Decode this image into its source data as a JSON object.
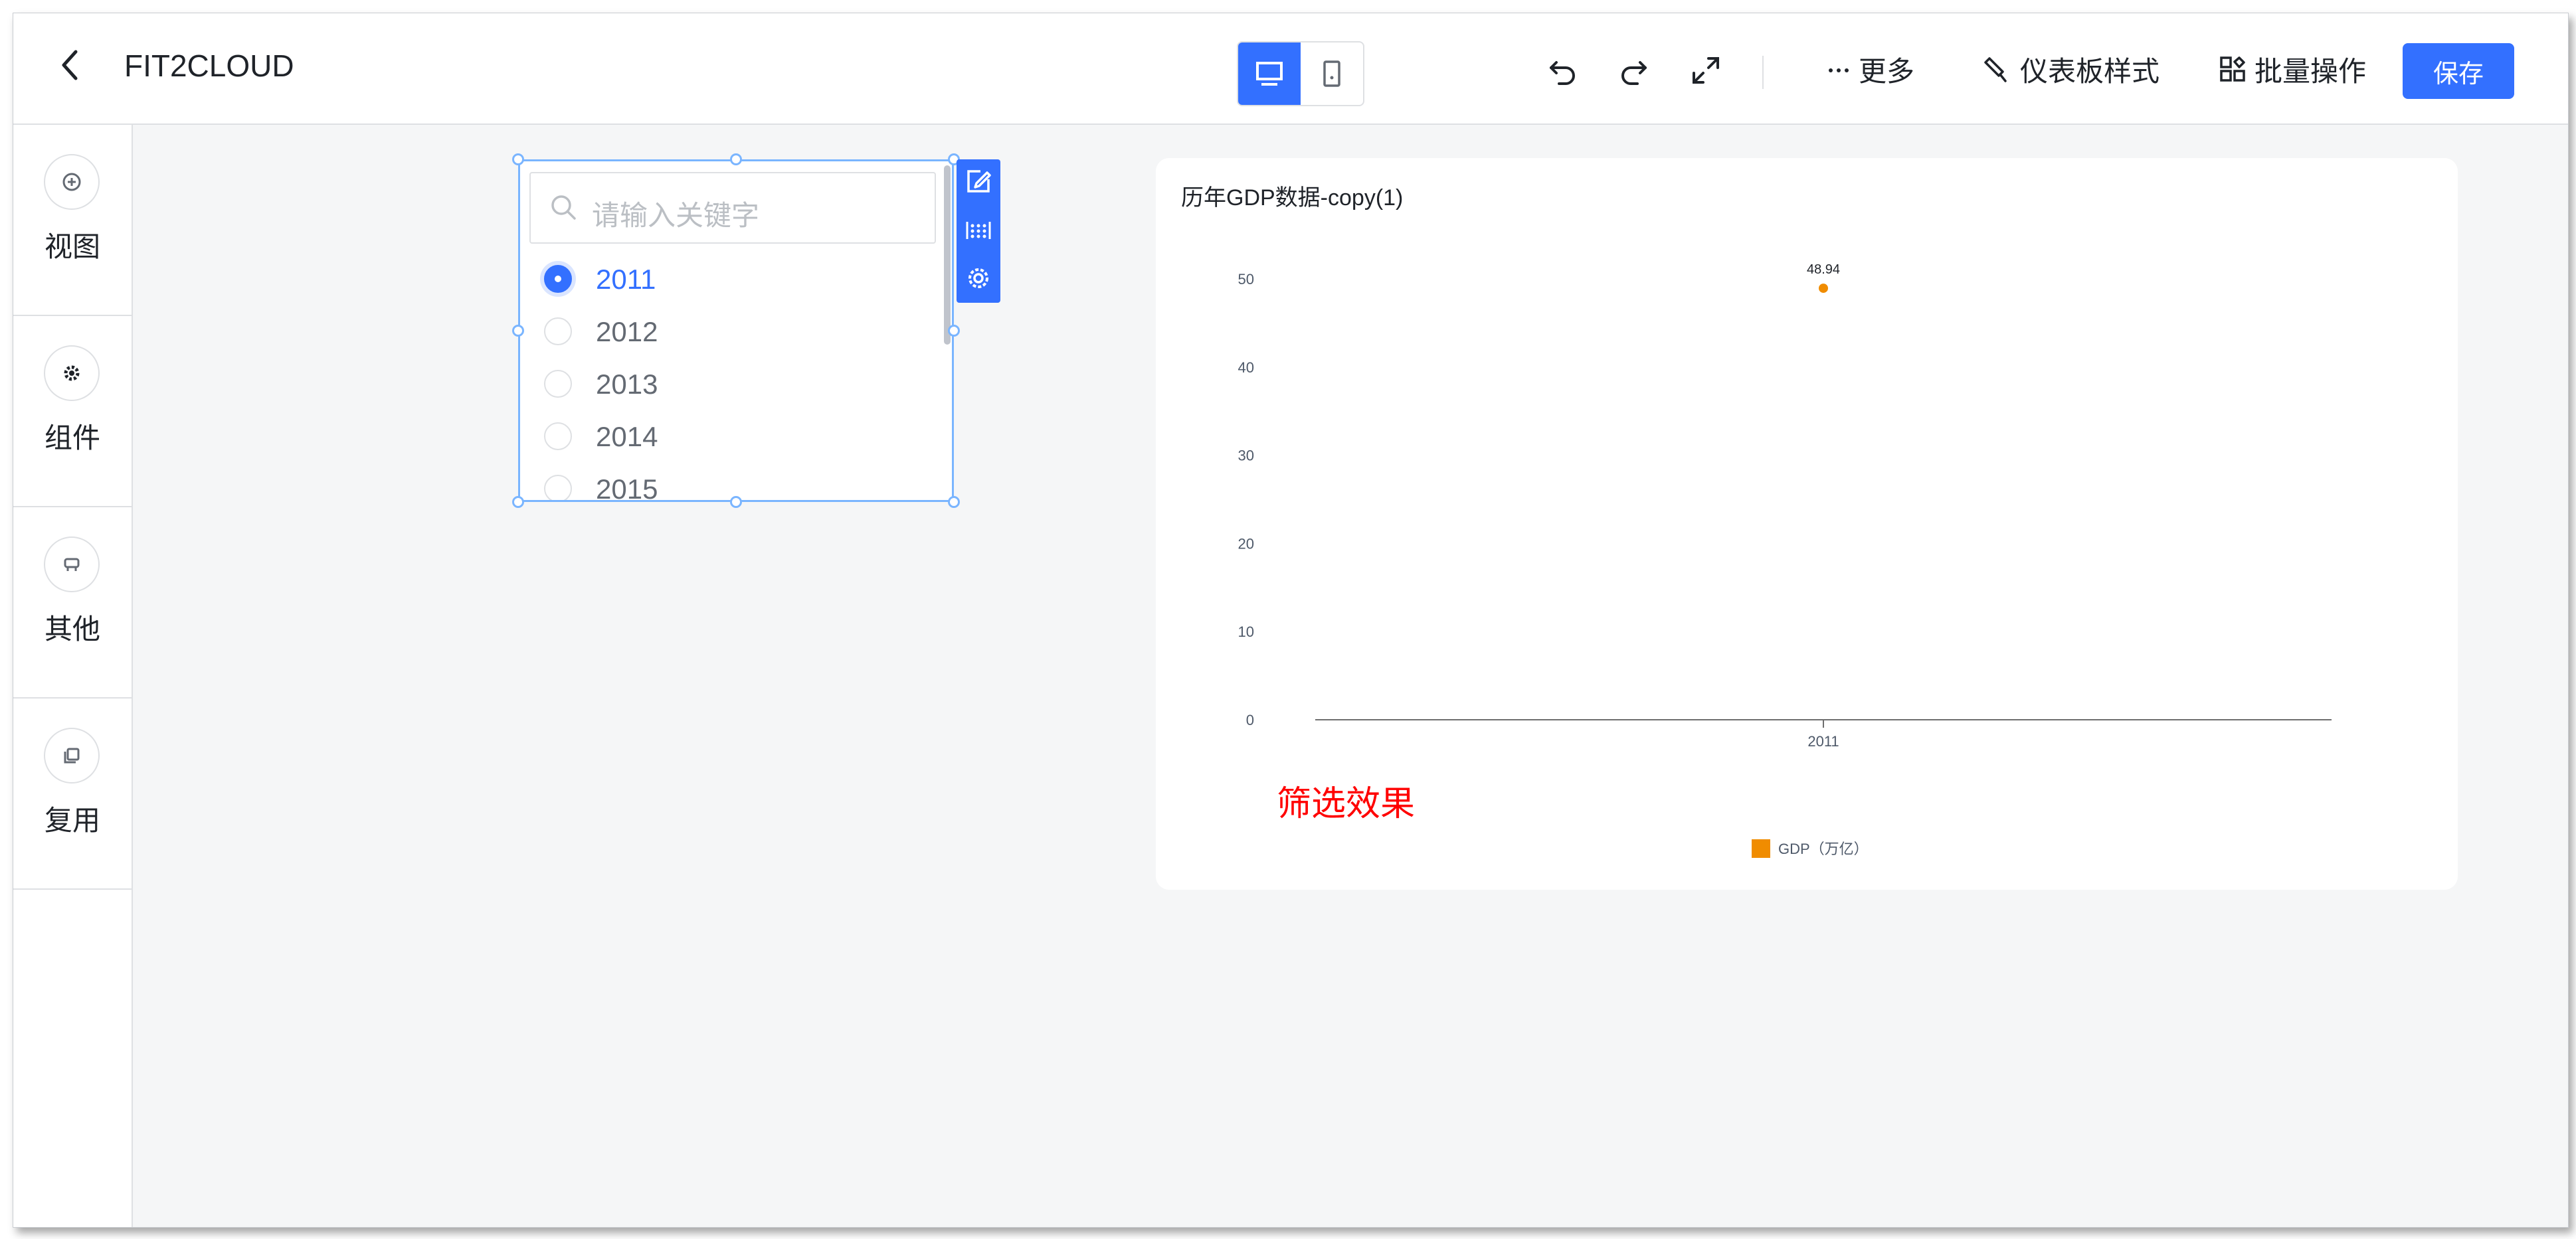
{
  "header": {
    "title": "FIT2CLOUD",
    "more_label": "更多",
    "style_label": "仪表板样式",
    "batch_label": "批量操作",
    "save_label": "保存"
  },
  "sidebar": {
    "items": [
      {
        "label": "视图",
        "icon": "plus-circle-icon"
      },
      {
        "label": "组件",
        "icon": "gear-icon"
      },
      {
        "label": "其他",
        "icon": "other-icon"
      },
      {
        "label": "复用",
        "icon": "copy-icon"
      }
    ]
  },
  "filter": {
    "placeholder": "请输入关键字",
    "options": [
      "2011",
      "2012",
      "2013",
      "2014",
      "2015"
    ],
    "selected": "2011"
  },
  "chart": {
    "title": "历年GDP数据-copy(1)",
    "note": "筛选效果"
  },
  "chart_data": {
    "type": "scatter",
    "title": "历年GDP数据-copy(1)",
    "categories": [
      "2011"
    ],
    "series": [
      {
        "name": "GDP（万亿）",
        "values": [
          48.94
        ],
        "color": "#f08c00"
      }
    ],
    "data_labels": [
      "48.94"
    ],
    "y_ticks": [
      "0",
      "10",
      "20",
      "30",
      "40",
      "50"
    ],
    "ylim": [
      0,
      50
    ],
    "xlabel": "",
    "ylabel": "",
    "grid": false,
    "legend": "bottom-center"
  },
  "colors": {
    "accent": "#3370ff",
    "series": "#f08c00",
    "note": "#ff0000"
  }
}
